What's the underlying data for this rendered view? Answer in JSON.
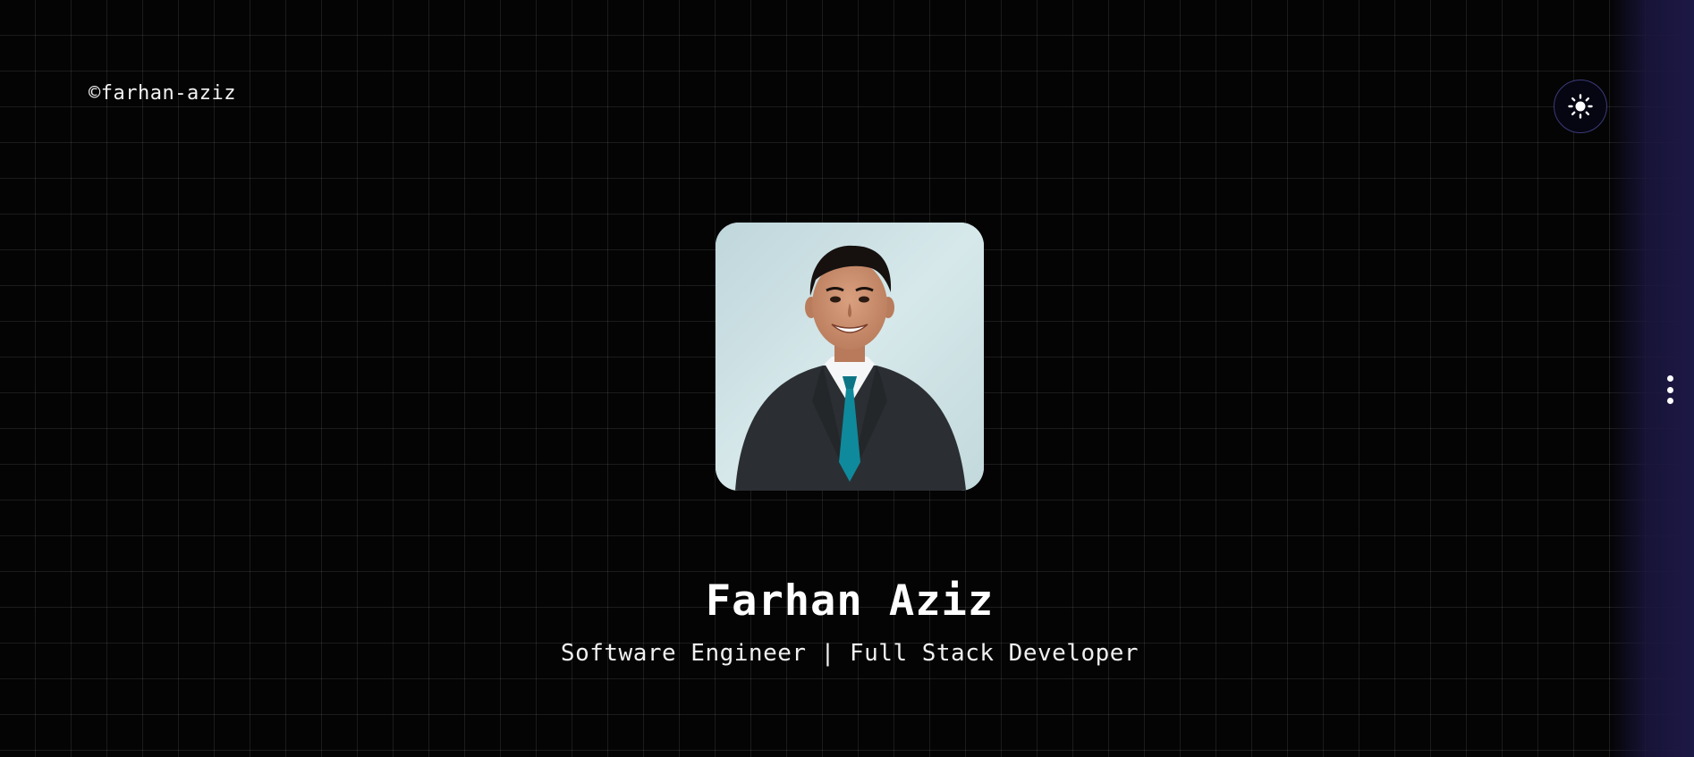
{
  "header": {
    "brand": "©farhan-aziz",
    "theme_toggle_icon": "sun-icon",
    "menu_icon": "kebab-menu-icon"
  },
  "profile": {
    "name": "Farhan Aziz",
    "subtitle": "Software Engineer | Full Stack Developer",
    "avatar_icon": "profile-photo"
  },
  "colors": {
    "background": "#050505",
    "grid_line": "#1c1c1c",
    "accent_border": "#3b3a7a",
    "side_glow": "#1d1946",
    "text": "#ffffff"
  }
}
